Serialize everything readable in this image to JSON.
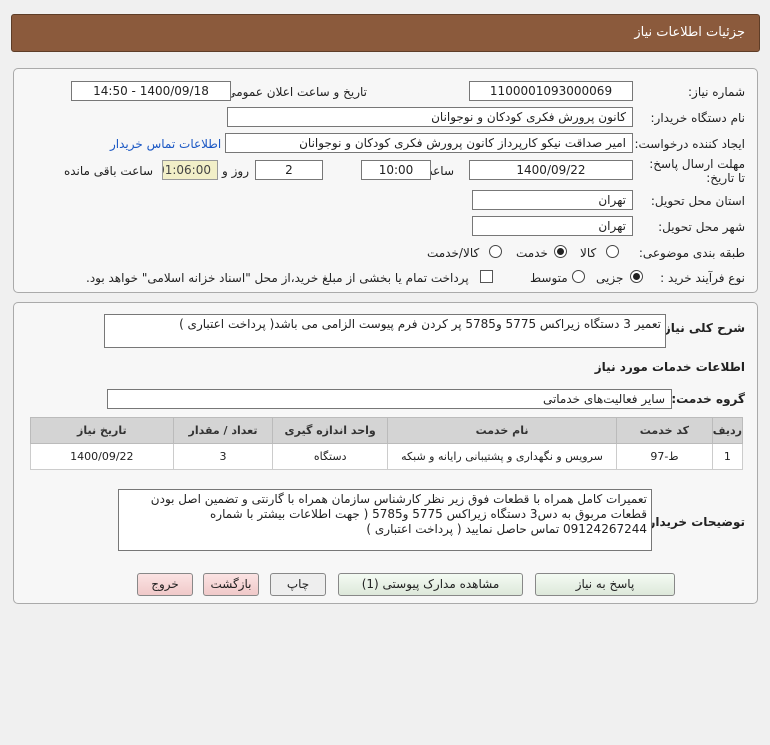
{
  "header": {
    "title": "جزئیات اطلاعات نیاز"
  },
  "info": {
    "need_number_label": "شماره نیاز:",
    "need_number": "1100001093000069",
    "announce_label": "تاریخ و ساعت اعلان عمومی:",
    "announce_value": "1400/09/18 - 14:50",
    "buyer_label": "نام دستگاه خریدار:",
    "buyer_value": "کانون پرورش فکری کودکان و نوجوانان",
    "creator_label": "ایجاد کننده درخواست:",
    "creator_value": "امیر صداقت نیکو کارپرداز کانون پرورش فکری کودکان و نوجوانان",
    "contact_link": "اطلاعات تماس خریدار",
    "deadline_label": "مهلت ارسال پاسخ: تا تاریخ:",
    "deadline_date": "1400/09/22",
    "time_label": "ساعت",
    "deadline_time": "10:00",
    "days_value": "2",
    "days_label": "روز و",
    "remaining_value": "01:06:00",
    "remaining_label": "ساعت باقی مانده",
    "province_label": "استان محل تحویل:",
    "province_value": "تهران",
    "city_label": "شهر محل تحویل:",
    "city_value": "تهران",
    "category_label": "طبقه بندی موضوعی:",
    "category_options": [
      "کالا",
      "خدمت",
      "کالا/خدمت"
    ],
    "category_selected": "خدمت",
    "process_label": "نوع فرآیند خرید :",
    "process_options": [
      "جزیی",
      "متوسط"
    ],
    "process_selected": "جزیی",
    "payment_note": "پرداخت تمام یا بخشی از مبلغ خرید،از محل \"اسناد خزانه اسلامی\" خواهد بود."
  },
  "summary": {
    "label": "شرح کلی نیاز:",
    "value": "تعمیر 3 دستگاه زیراکس 5775 و5785 پر کردن فرم پیوست الزامی می باشد( پرداخت اعتباری )",
    "services_heading": "اطلاعات خدمات مورد نیاز",
    "group_label": "گروه خدمت:",
    "group_value": "سایر فعالیت‌های خدماتی",
    "table_headers": [
      "ردیف",
      "کد خدمت",
      "نام خدمت",
      "واحد اندازه گیری",
      "تعداد / مقدار",
      "تاریخ نیاز"
    ],
    "rows": [
      [
        "1",
        "ط-97",
        "سرویس و نگهداری و پشتیبانی رایانه و شبکه",
        "دستگاه",
        "3",
        "1400/09/22"
      ]
    ],
    "buyer_notes_label": "توضیحات خریدار:",
    "buyer_notes": "تعمیرات کامل همراه با قطعات فوق زیر نظر کارشناس سازمان همراه با گارنتی و تضمین اصل بودن قطعات مربوق به دس3 دستگاه زیراکس 5775 و5785 ( جهت اطلاعات بیشتر با شماره 09124267244 تماس حاصل نمایید ( پرداخت اعتباری )"
  },
  "buttons": {
    "reply": "پاسخ به نیاز",
    "attachments": "مشاهده مدارک پیوستی (1)",
    "print": "چاپ",
    "back": "بازگشت",
    "exit": "خروج"
  }
}
